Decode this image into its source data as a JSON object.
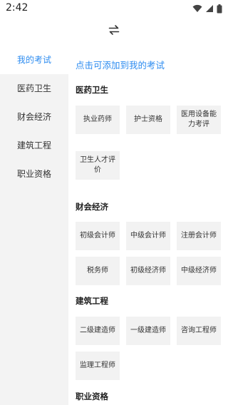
{
  "status": {
    "time": "2:42",
    "icons": [
      "wifi-icon",
      "signal-icon",
      "battery-icon"
    ]
  },
  "toolbar": {
    "switch_icon": "swap-arrows-icon"
  },
  "colors": {
    "accent": "#2d8cf0",
    "sidebar_bg": "#f3f3f3",
    "tile_bg": "#f2f2f2"
  },
  "sidebar": {
    "items": [
      {
        "label": "我的考试",
        "active": true
      },
      {
        "label": "医药卫生",
        "active": false
      },
      {
        "label": "财会经济",
        "active": false
      },
      {
        "label": "建筑工程",
        "active": false
      },
      {
        "label": "职业资格",
        "active": false
      }
    ]
  },
  "main": {
    "hint": "点击可添加到我的考试",
    "sections": [
      {
        "title": "医药卫生",
        "items": [
          "执业药师",
          "护士资格",
          "医用设备能力考评",
          "卫生人才评价"
        ]
      },
      {
        "title": "财会经济",
        "items": [
          "初级会计师",
          "中级会计师",
          "注册会计师",
          "税务师",
          "初级经济师",
          "中级经济师"
        ]
      },
      {
        "title": "建筑工程",
        "items": [
          "二级建造师",
          "一级建造师",
          "咨询工程师",
          "监理工程师"
        ]
      },
      {
        "title": "职业资格",
        "items": []
      }
    ]
  }
}
